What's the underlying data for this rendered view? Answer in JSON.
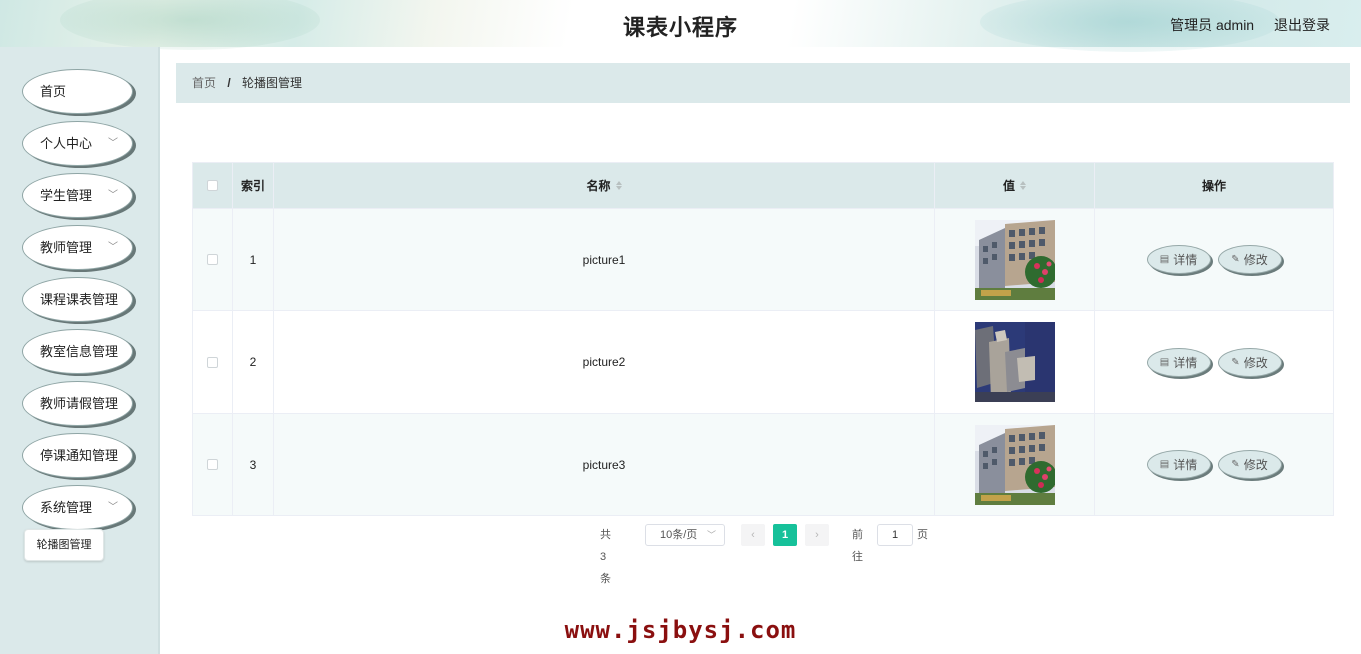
{
  "header": {
    "title": "课表小程序",
    "user_label": "管理员 admin",
    "logout_label": "退出登录"
  },
  "sidebar": {
    "items": [
      {
        "label": "首页",
        "has_children": false
      },
      {
        "label": "个人中心",
        "has_children": true
      },
      {
        "label": "学生管理",
        "has_children": true
      },
      {
        "label": "教师管理",
        "has_children": true
      },
      {
        "label": "课程课表管理",
        "has_children": false
      },
      {
        "label": "教室信息管理",
        "has_children": false
      },
      {
        "label": "教师请假管理",
        "has_children": false
      },
      {
        "label": "停课通知管理",
        "has_children": false
      },
      {
        "label": "系统管理",
        "has_children": true
      }
    ],
    "sub_item": "轮播图管理"
  },
  "breadcrumb": {
    "home": "首页",
    "separator": "/",
    "current": "轮播图管理"
  },
  "table": {
    "columns": {
      "index": "索引",
      "name": "名称",
      "value": "值",
      "actions": "操作"
    },
    "rows": [
      {
        "index": "1",
        "name": "picture1",
        "image": "building-photo"
      },
      {
        "index": "2",
        "name": "picture2",
        "image": "abstract-blocks-photo"
      },
      {
        "index": "3",
        "name": "picture3",
        "image": "building-photo"
      }
    ],
    "detail_label": "详情",
    "edit_label": "修改"
  },
  "pagination": {
    "total": "共 3 条",
    "page_size": "10条/页",
    "current_page": "1",
    "goto_label": "前往",
    "goto_value": "1",
    "page_suffix": "页"
  },
  "watermark": "www.jsjbysj.com",
  "colors": {
    "accent": "#16c19a",
    "sidebar_bg": "#dbe9ea",
    "watermark": "#8a0f0f"
  }
}
